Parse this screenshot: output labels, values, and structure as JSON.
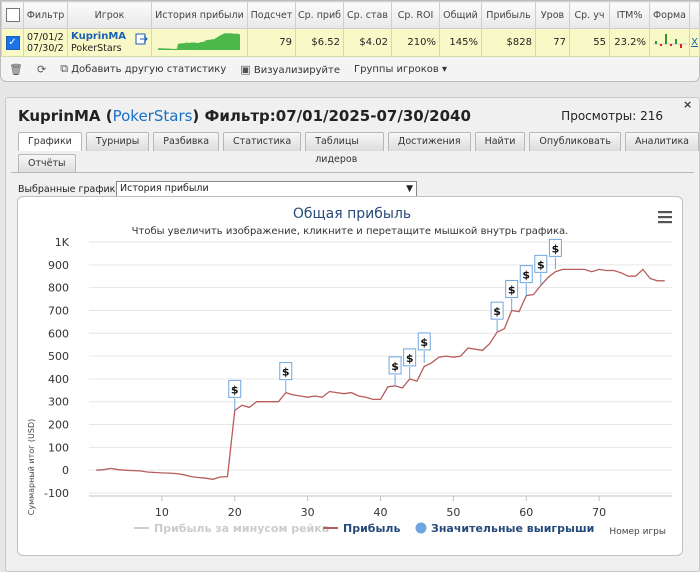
{
  "grid": {
    "headers": [
      "",
      "Фильтр",
      "Игрок",
      "История прибыли",
      "Подсчет",
      "Ср. приб",
      "Ср. став",
      "Ср. ROI",
      "Общий",
      "Прибыль",
      "Уров",
      "Ср. уч",
      "ITM%",
      "Форма",
      ""
    ],
    "row": {
      "filter_line1": "07/01/2",
      "filter_line2": "07/30/2",
      "player_name": "KuprinMA",
      "player_site": "PokerStars",
      "count": "79",
      "avg_profit": "$6.52",
      "avg_stake": "$4.02",
      "avg_roi": "210%",
      "total": "145%",
      "profit": "$828",
      "level": "77",
      "avg_field": "55",
      "itm": "23.2%",
      "remove": "X"
    }
  },
  "toolbar": {
    "add_stats": "Добавить другую статистику",
    "visualize": "Визуализируйте",
    "player_groups": "Группы игроков"
  },
  "panel": {
    "name": "KuprinMA",
    "open_paren": " (",
    "site": "PokerStars",
    "filter": ") Фильтр:07/01/2025-07/30/2040",
    "views": "Просмотры: 216",
    "close": "×",
    "tabs_row1": [
      "Графики",
      "Турниры",
      "Разбивка",
      "Статистика",
      "Таблицы лидеров",
      "Достижения",
      "Найти",
      "Опубликовать",
      "Аналитика"
    ],
    "tabs_row2": [
      "Отчёты"
    ],
    "selector_label": "Выбранные графики:",
    "selector_value": "История прибыли"
  },
  "colors": {
    "profit_line": "#b85c5c",
    "rake_line": "#cccccc",
    "marker": "#6ea6e0",
    "accent": "#1a6fc4"
  },
  "chart_data": {
    "type": "line",
    "title": "Общая прибыль",
    "subtitle": "Чтобы увеличить изображение, кликните и перетащите мышкой внутрь графика.",
    "ylabel": "Суммарный итог (USD)",
    "xlabel": "Номер игры",
    "xlim": [
      0,
      80
    ],
    "ylim": [
      -100,
      1000
    ],
    "xticks": [
      10,
      20,
      30,
      40,
      50,
      60,
      70
    ],
    "yticks": [
      -100,
      0,
      100,
      200,
      300,
      400,
      500,
      600,
      700,
      800,
      900,
      1000
    ],
    "ytick_labels": [
      "-100",
      "0",
      "100",
      "200",
      "300",
      "400",
      "500",
      "600",
      "700",
      "800",
      "900",
      "1K"
    ],
    "legend": [
      "Прибыль за минусом рейка",
      "Прибыль",
      "Значительные выигрыши"
    ],
    "legend_position": "bottom",
    "series": [
      {
        "name": "Прибыль",
        "x": [
          1,
          2,
          3,
          4,
          5,
          6,
          7,
          8,
          9,
          10,
          11,
          12,
          13,
          14,
          15,
          16,
          17,
          18,
          19,
          20,
          21,
          22,
          23,
          24,
          25,
          26,
          27,
          28,
          29,
          30,
          31,
          32,
          33,
          34,
          35,
          36,
          37,
          38,
          39,
          40,
          41,
          42,
          43,
          44,
          45,
          46,
          47,
          48,
          49,
          50,
          51,
          52,
          53,
          54,
          55,
          56,
          57,
          58,
          59,
          60,
          61,
          62,
          63,
          64,
          65,
          66,
          67,
          68,
          69,
          70,
          71,
          72,
          73,
          74,
          75,
          76,
          77,
          78,
          79
        ],
        "y": [
          0,
          2,
          8,
          2,
          0,
          -2,
          -3,
          -8,
          -10,
          -12,
          -13,
          -15,
          -20,
          -28,
          -32,
          -35,
          -40,
          -30,
          -28,
          262,
          285,
          275,
          300,
          300,
          300,
          300,
          340,
          330,
          325,
          320,
          325,
          320,
          345,
          340,
          335,
          340,
          325,
          320,
          310,
          310,
          365,
          370,
          360,
          400,
          390,
          455,
          470,
          495,
          500,
          495,
          500,
          535,
          530,
          525,
          555,
          605,
          620,
          700,
          695,
          765,
          770,
          810,
          845,
          870,
          880,
          880,
          880,
          880,
          870,
          880,
          875,
          875,
          865,
          850,
          850,
          880,
          840,
          830,
          830
        ]
      }
    ],
    "big_wins": {
      "x": [
        20,
        27,
        42,
        44,
        46,
        56,
        58,
        60,
        62,
        64
      ],
      "y": [
        262,
        340,
        365,
        400,
        470,
        605,
        700,
        765,
        810,
        880
      ]
    }
  }
}
